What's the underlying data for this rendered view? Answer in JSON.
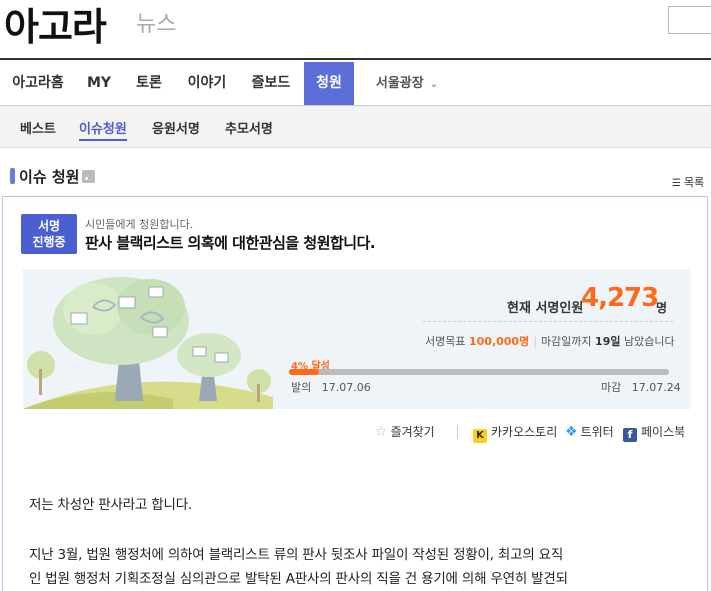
{
  "header": {
    "logo": "아고라",
    "section": "뉴스"
  },
  "main_nav": {
    "items": [
      "아고라홈",
      "MY",
      "토론",
      "이야기",
      "즐보드",
      "청원",
      "서울광장"
    ],
    "active": "청원"
  },
  "sub_nav": {
    "items": [
      "베스트",
      "이슈청원",
      "응원서명",
      "추모서명"
    ],
    "active": "이슈청원"
  },
  "section": {
    "title": "이슈 청원",
    "list_label": "목록"
  },
  "petition": {
    "badge_line1": "서명",
    "badge_line2": "진행중",
    "subtitle": "시민들에게 청원합니다.",
    "title": "판사 블랙리스트 의혹에 대한관심을 청원합니다.",
    "signers_label": "현재 서명인원",
    "signers_count": "4,273",
    "signers_unit": "명",
    "goal_label": "서명목표",
    "goal_value": "100,000명",
    "deadline_prefix": "마감일까지",
    "deadline_days": "19일",
    "deadline_suffix": "남았습니다",
    "progress_label": "4% 달성",
    "progress_fraction": 0.04,
    "start_label": "발의",
    "start_date": "17.07.06",
    "end_label": "마감",
    "end_date": "17.07.24"
  },
  "share": {
    "bookmark": "즐겨찾기",
    "kakao": "카카오스토리",
    "twitter": "트위터",
    "facebook": "페이스북"
  },
  "body": {
    "p1": "저는 차성안 판사라고 합니다.",
    "p2_line1": "지난 3월, 법원 행정처에 의하여 블랙리스트 류의 판사 뒷조사 파일이 작성된 정황이, 최고의 요직",
    "p2_line2": "인 법원 행정처 기획조정실 심의관으로 발탁된 A판사의 판사의 직을 건 용기에 의해 우연히 발견되"
  },
  "colors": {
    "accent": "#5b6ed8",
    "highlight": "#ff6a1a"
  }
}
